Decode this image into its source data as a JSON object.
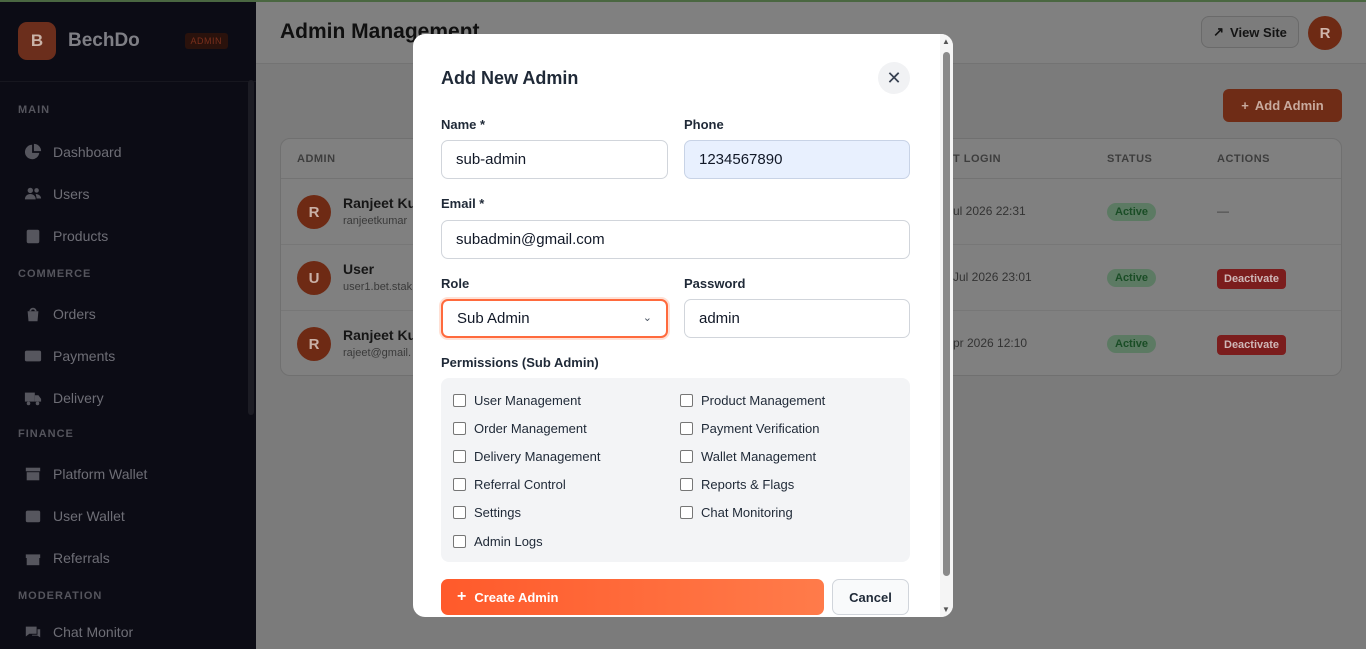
{
  "app": {
    "logo_letter": "B",
    "name": "BechDo",
    "badge": "ADMIN"
  },
  "sidebar": {
    "sections": [
      {
        "title": "MAIN",
        "items": [
          {
            "label": "Dashboard",
            "icon": "pie-chart-icon"
          },
          {
            "label": "Users",
            "icon": "users-icon"
          },
          {
            "label": "Products",
            "icon": "box-icon"
          }
        ]
      },
      {
        "title": "COMMERCE",
        "items": [
          {
            "label": "Orders",
            "icon": "bag-icon"
          },
          {
            "label": "Payments",
            "icon": "credit-card-icon"
          },
          {
            "label": "Delivery",
            "icon": "truck-icon"
          }
        ]
      },
      {
        "title": "FINANCE",
        "items": [
          {
            "label": "Platform Wallet",
            "icon": "store-icon"
          },
          {
            "label": "User Wallet",
            "icon": "wallet-icon"
          },
          {
            "label": "Referrals",
            "icon": "gift-icon"
          }
        ]
      },
      {
        "title": "MODERATION",
        "items": [
          {
            "label": "Chat Monitor",
            "icon": "chat-icon"
          }
        ]
      }
    ]
  },
  "header": {
    "title": "Admin Management",
    "view_site": "View Site",
    "avatar": "R"
  },
  "add_admin": "Add Admin",
  "table": {
    "headers": {
      "admin": "ADMIN",
      "last_login": "T LOGIN",
      "status": "STATUS",
      "actions": "ACTIONS"
    },
    "rows": [
      {
        "avatar": "R",
        "name": "Ranjeet Ku",
        "email": "ranjeetkumar",
        "last_login": "ul 2026 22:31",
        "status": "Active",
        "action": "—"
      },
      {
        "avatar": "U",
        "name": "User",
        "email": "user1.bet.stak",
        "last_login": "Jul 2026 23:01",
        "status": "Active",
        "action": "Deactivate"
      },
      {
        "avatar": "R",
        "name": "Ranjeet Ku",
        "email": "rajeet@gmail.",
        "last_login": "pr 2026 12:10",
        "status": "Active",
        "action": "Deactivate"
      }
    ]
  },
  "modal": {
    "title": "Add New Admin",
    "close": "✕",
    "name_label": "Name *",
    "name_value": "sub-admin",
    "phone_label": "Phone",
    "phone_value": "1234567890",
    "email_label": "Email *",
    "email_value": "subadmin@gmail.com",
    "role_label": "Role",
    "role_value": "Sub Admin",
    "password_label": "Password",
    "password_value": "admin",
    "permissions_label": "Permissions (Sub Admin)",
    "permissions_left": [
      "User Management",
      "Order Management",
      "Delivery Management",
      "Referral Control",
      "Settings",
      "Admin Logs"
    ],
    "permissions_right": [
      "Product Management",
      "Payment Verification",
      "Wallet Management",
      "Reports & Flags",
      "Chat Monitoring"
    ],
    "create_button": "Create Admin",
    "cancel_button": "Cancel"
  }
}
